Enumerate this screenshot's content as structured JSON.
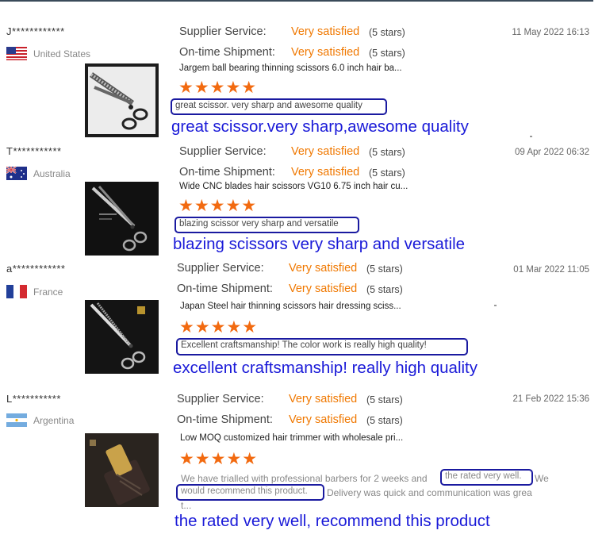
{
  "reviews": [
    {
      "user": "J************",
      "country": "United States",
      "flag": "us-flag",
      "supplier_label": "Supplier Service:",
      "supplier_value": "Very satisfied",
      "supplier_stars": "(5 stars)",
      "shipment_label": "On-time Shipment:",
      "shipment_value": "Very satisfied",
      "shipment_stars": "(5 stars)",
      "date": "11 May 2022 16:13",
      "product": "Jargem ball bearing thinning scissors 6.0 inch hair ba...",
      "stars": "★★★★★",
      "comment": "great scissor. very sharp and awesome quality",
      "caption": "great scissor.very sharp,awesome quality"
    },
    {
      "user": "T***********",
      "country": "Australia",
      "flag": "au-flag",
      "supplier_label": "Supplier Service:",
      "supplier_value": "Very satisfied",
      "supplier_stars": "(5 stars)",
      "shipment_label": "On-time Shipment:",
      "shipment_value": "Very satisfied",
      "shipment_stars": "(5 stars)",
      "date": "09 Apr 2022 06:32",
      "product": "Wide CNC blades hair scissors VG10 6.75 inch hair cu...",
      "stars": "★★★★★",
      "comment": "blazing scissor very sharp and versatile",
      "caption": "blazing scissors very sharp and versatile"
    },
    {
      "user": "a************",
      "country": "France",
      "flag": "fr-flag",
      "supplier_label": "Supplier Service:",
      "supplier_value": "Very satisfied",
      "supplier_stars": "(5 stars)",
      "shipment_label": "On-time Shipment:",
      "shipment_value": "Very satisfied",
      "shipment_stars": "(5 stars)",
      "date": "01 Mar 2022 11:05",
      "product": "Japan Steel hair thinning scissors hair dressing sciss...",
      "stars": "★★★★★",
      "comment": "Excellent craftsmanship! The color work is really high quality!",
      "caption": "excellent craftsmanship! really high quality"
    },
    {
      "user": "L***********",
      "country": "Argentina",
      "flag": "ar-flag",
      "supplier_label": "Supplier Service:",
      "supplier_value": "Very satisfied",
      "supplier_stars": "(5 stars)",
      "shipment_label": "On-time Shipment:",
      "shipment_value": "Very satisfied",
      "shipment_stars": "(5 stars)",
      "date": "21 Feb 2022 15:36",
      "product": "Low MOQ customized hair trimmer with wholesale pri...",
      "stars": "★★★★★",
      "comment_part1": "We have trialled with professional barbers for 2 weeks and",
      "comment_hl1": "the rated very well.",
      "comment_part2": "We",
      "comment_hl2": "would recommend this product.",
      "comment_part3": "Delivery was quick and communication was grea",
      "comment_part4": "t...",
      "caption": "the rated very well, recommend this product"
    }
  ]
}
